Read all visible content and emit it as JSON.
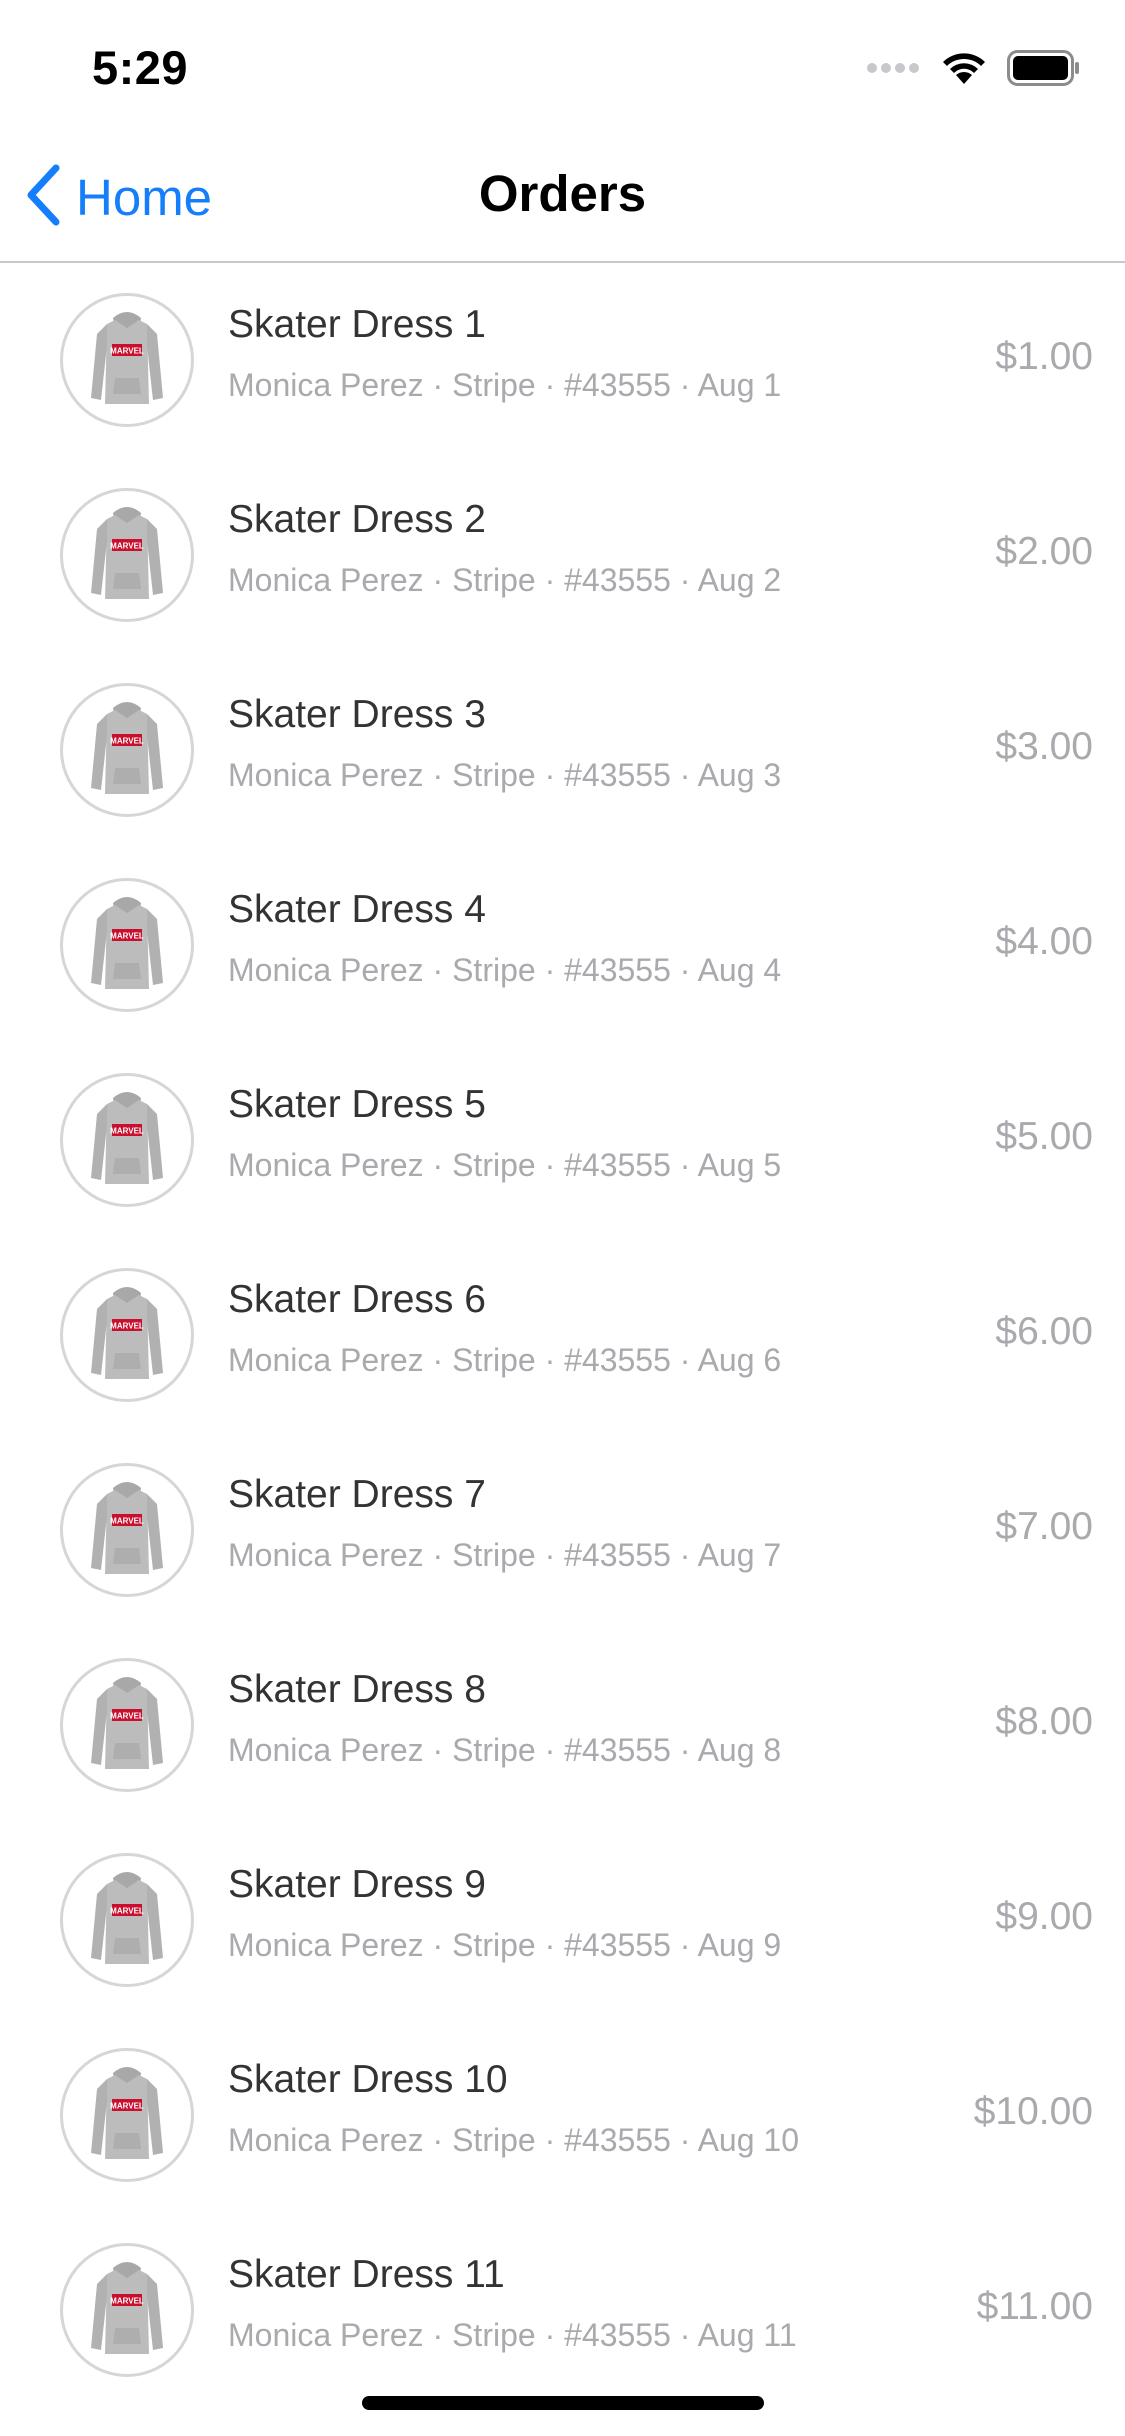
{
  "status_bar": {
    "time": "5:29",
    "icons": [
      "signal-dots-icon",
      "wifi-icon",
      "battery-icon"
    ]
  },
  "nav": {
    "back_label": "Home",
    "title": "Orders",
    "accent_color": "#147efb"
  },
  "orders": [
    {
      "title": "Skater Dress 1",
      "subtitle": "Monica Perez · Stripe · #43555 · Aug 1",
      "price": "$1.00"
    },
    {
      "title": "Skater Dress 2",
      "subtitle": "Monica Perez · Stripe · #43555 · Aug 2",
      "price": "$2.00"
    },
    {
      "title": "Skater Dress 3",
      "subtitle": "Monica Perez · Stripe · #43555 · Aug 3",
      "price": "$3.00"
    },
    {
      "title": "Skater Dress 4",
      "subtitle": "Monica Perez · Stripe · #43555 · Aug 4",
      "price": "$4.00"
    },
    {
      "title": "Skater Dress 5",
      "subtitle": "Monica Perez · Stripe · #43555 · Aug 5",
      "price": "$5.00"
    },
    {
      "title": "Skater Dress 6",
      "subtitle": "Monica Perez · Stripe · #43555 · Aug 6",
      "price": "$6.00"
    },
    {
      "title": "Skater Dress 7",
      "subtitle": "Monica Perez · Stripe · #43555 · Aug 7",
      "price": "$7.00"
    },
    {
      "title": "Skater Dress 8",
      "subtitle": "Monica Perez · Stripe · #43555 · Aug 8",
      "price": "$8.00"
    },
    {
      "title": "Skater Dress 9",
      "subtitle": "Monica Perez · Stripe · #43555 · Aug 9",
      "price": "$9.00"
    },
    {
      "title": "Skater Dress 10",
      "subtitle": "Monica Perez · Stripe · #43555 · Aug 10",
      "price": "$10.00"
    },
    {
      "title": "Skater Dress 11",
      "subtitle": "Monica Perez · Stripe · #43555 · Aug 11",
      "price": "$11.00"
    }
  ],
  "thumbnail": {
    "icon": "hoodie-icon",
    "brand_text": "MARVEL",
    "garment_color": "#b9b9b9",
    "brand_color": "#c8102e"
  }
}
